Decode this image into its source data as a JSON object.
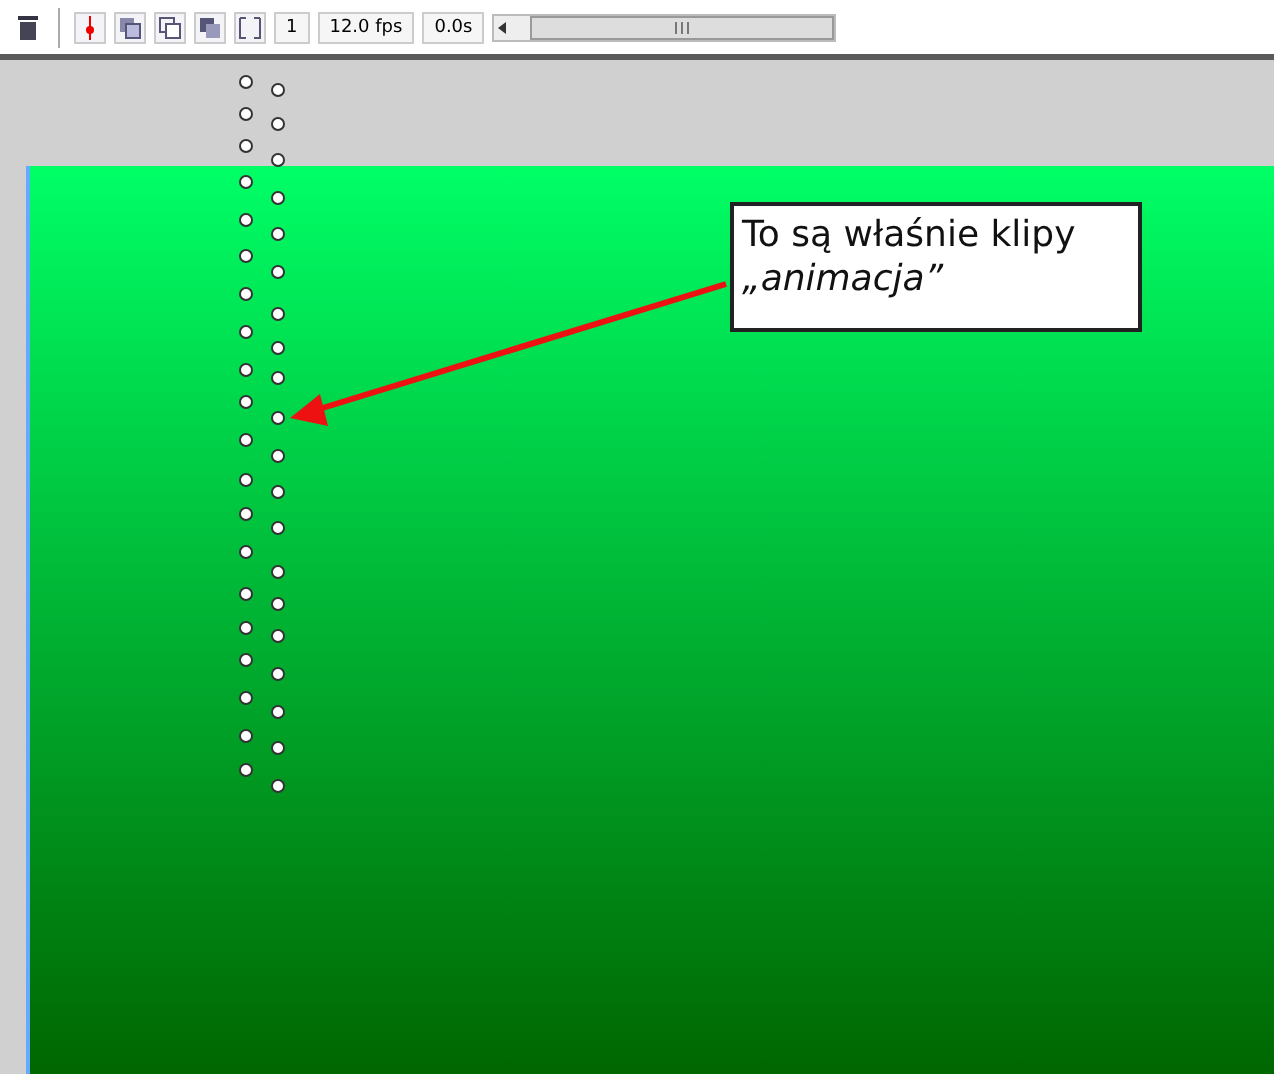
{
  "toolbar": {
    "frame": "1",
    "fps": "12.0 fps",
    "time": "0.0s"
  },
  "callout": {
    "text": "To są właśnie klipy\n*„animacja”*"
  }
}
